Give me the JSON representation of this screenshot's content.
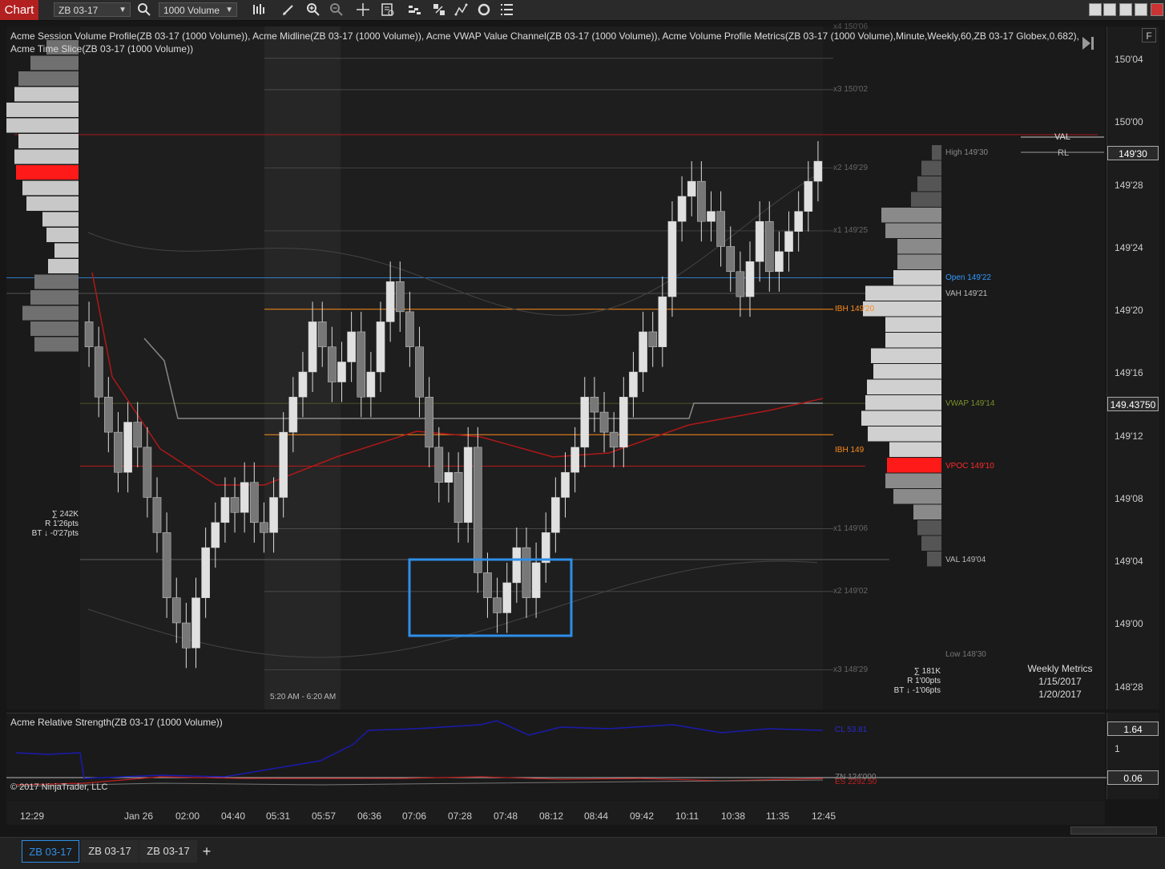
{
  "toolbar": {
    "chart_label": "Chart",
    "instrument": "ZB 03-17",
    "bar_type": "1000 Volume"
  },
  "indicators_line": "Acme Session Volume Profile(ZB 03-17 (1000 Volume)), Acme Midline(ZB 03-17 (1000 Volume)), Acme VWAP Value Channel(ZB 03-17 (1000 Volume)), Acme Volume Profile Metrics(ZB 03-17 (1000 Volume),Minute,Weekly,60,ZB 03-17 Globex,0.682), Acme Time Slice(ZB 03-17 (1000 Volume))",
  "price_axis": {
    "ticks": [
      "150'04",
      "150'00",
      "149'28",
      "149'24",
      "149'20",
      "149'16",
      "149'12",
      "149'08",
      "149'04",
      "149'00",
      "148'28"
    ],
    "last_price": "149'30",
    "vwap_badge": "149.43750",
    "f_button": "F"
  },
  "right_labels": {
    "val": "VAL",
    "rl": "RL",
    "high": "High 149'30",
    "x2_top": "x2 149'29",
    "x1_top": "x1 149'25",
    "x3_top": "x3 150'02",
    "x4_top": "x4 150'06",
    "open": "Open 149'22",
    "vah": "VAH 149'21",
    "ibh": "IBH 149'20",
    "vwap": "VWAP 149'14",
    "ibl": "IBH 149",
    "vpoc": "VPOC 149'10",
    "x1_bot": "x1 149'06",
    "val_bot": "VAL 149'04",
    "x2_bot": "x2 149'02",
    "low": "Low 148'30",
    "x3_bot": "x3 148'29"
  },
  "left_stats": {
    "sum": "∑ 242K",
    "range": "R 1'26pts",
    "bt": "BT ↓ -0'27pts"
  },
  "right_stats": {
    "sum": "∑ 181K",
    "range": "R 1'00pts",
    "bt": "BT ↓ -1'06pts"
  },
  "weekly_metrics": {
    "title": "Weekly Metrics",
    "start": "1/15/2017",
    "end": "1/20/2017"
  },
  "time_slice_label": "5:20 AM - 6:20 AM",
  "sub_panel": {
    "title": "Acme Relative Strength(ZB 03-17 (1000 Volume))",
    "copyright": "© 2017 NinjaTrader, LLC",
    "cl_label": "CL 53.81",
    "zn_label": "ZN 124'000",
    "es_label": "ES 2292.50",
    "badge_top": "1.64",
    "tick_one": "1",
    "badge_bottom": "0.06"
  },
  "time_axis": [
    "12:29",
    "Jan 26",
    "02:00",
    "04:40",
    "05:31",
    "05:57",
    "06:36",
    "07:06",
    "07:28",
    "07:48",
    "08:12",
    "08:44",
    "09:42",
    "10:11",
    "10:38",
    "11:35",
    "12:45"
  ],
  "tabs": [
    "ZB 03-17",
    "ZB 03-17",
    "ZB 03-17"
  ],
  "colors": {
    "accent": "#2e8ee8",
    "vpoc": "#ff1a1a",
    "ib": "#ff8c1a",
    "open": "#3399ff",
    "vwap": "#b01818",
    "rs_cl": "#1a1ab0",
    "rs_es": "#c02020"
  },
  "chart_data": {
    "type": "candlestick",
    "instrument": "ZB 03-17",
    "price_ticks": [
      "150'04",
      "150'00",
      "149'28",
      "149'24",
      "149'20",
      "149'16",
      "149'12",
      "149'08",
      "149'04",
      "149'00",
      "148'28"
    ],
    "time_ticks": [
      "12:29",
      "Jan 26",
      "02:00",
      "04:40",
      "05:31",
      "05:57",
      "06:36",
      "07:06",
      "07:28",
      "07:48",
      "08:12",
      "08:44",
      "09:42",
      "10:11",
      "10:38",
      "11:35",
      "12:45"
    ],
    "levels": {
      "high": 149.9375,
      "open": 149.6875,
      "vah": 149.65625,
      "ibh": 149.625,
      "vwap": 149.4375,
      "ib_low": 149.375,
      "vpoc": 149.3125,
      "val": 149.125,
      "low": 148.9375
    },
    "closes": [
      149.55,
      149.45,
      149.38,
      149.3,
      149.4,
      149.35,
      149.25,
      149.18,
      149.05,
      149.0,
      148.95,
      149.05,
      149.15,
      149.2,
      149.25,
      149.22,
      149.28,
      149.2,
      149.18,
      149.25,
      149.38,
      149.45,
      149.5,
      149.6,
      149.55,
      149.48,
      149.52,
      149.58,
      149.45,
      149.5,
      149.6,
      149.68,
      149.62,
      149.55,
      149.45,
      149.35,
      149.28,
      149.3,
      149.2,
      149.35,
      149.1,
      149.05,
      149.02,
      149.08,
      149.15,
      149.05,
      149.12,
      149.18,
      149.25,
      149.3,
      149.35,
      149.45,
      149.42,
      149.38,
      149.35,
      149.45,
      149.5,
      149.58,
      149.55,
      149.65,
      149.8,
      149.85,
      149.88,
      149.8,
      149.82,
      149.75,
      149.7,
      149.65,
      149.72,
      149.8,
      149.7,
      149.74,
      149.78,
      149.82,
      149.88,
      149.92
    ]
  }
}
